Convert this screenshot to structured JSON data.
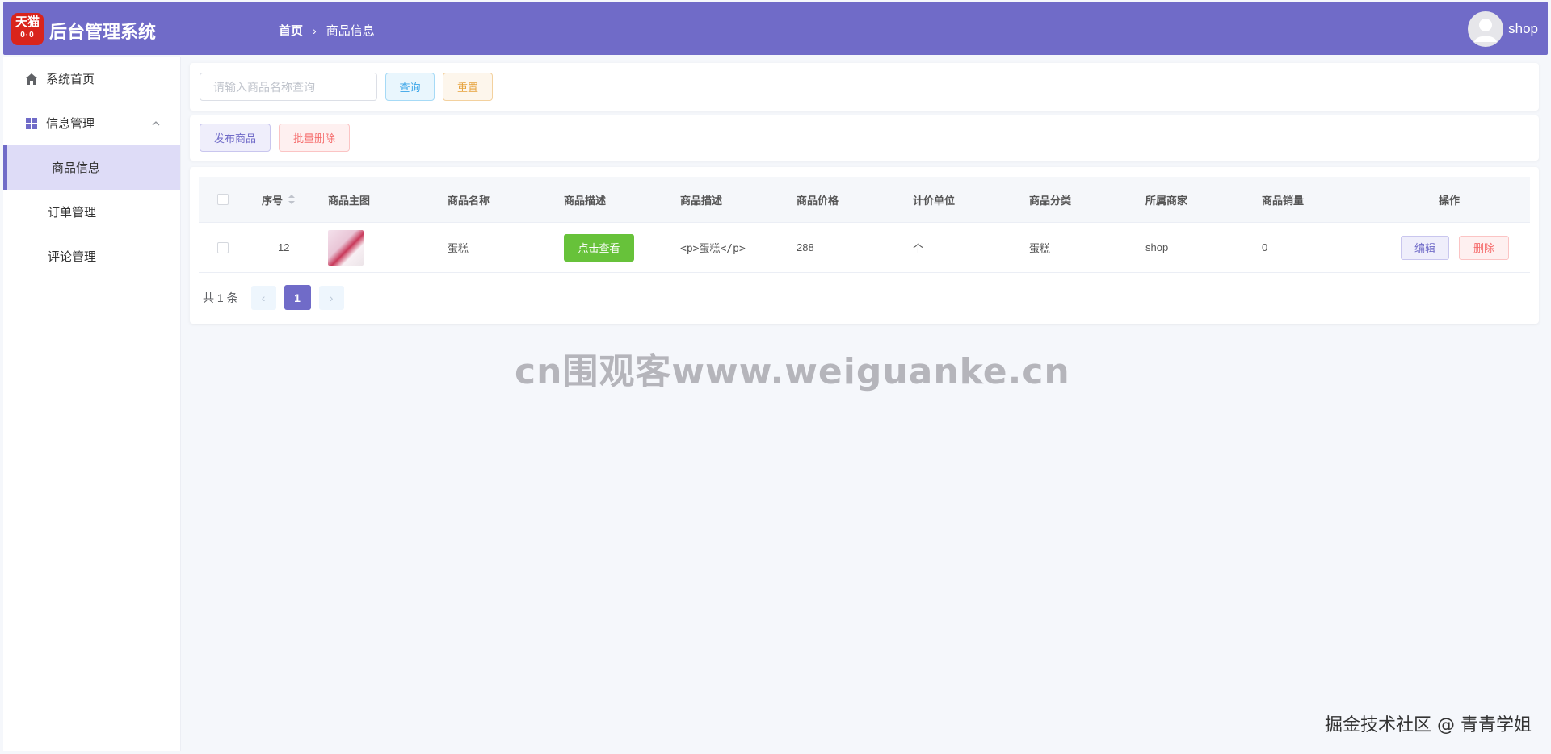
{
  "app": {
    "title": "后台管理系统",
    "logo_text": "天猫",
    "logo_sub": "0·0"
  },
  "breadcrumb": {
    "home": "首页",
    "separator": "›",
    "current": "商品信息"
  },
  "user": {
    "name": "shop",
    "avatar_icon": "user-avatar-icon"
  },
  "sidebar": {
    "items": [
      {
        "label": "系统首页",
        "icon": "home-icon"
      },
      {
        "label": "信息管理",
        "icon": "grid-icon",
        "expanded": true
      },
      {
        "label": "商品信息",
        "active": true
      },
      {
        "label": "订单管理"
      },
      {
        "label": "评论管理"
      }
    ]
  },
  "search": {
    "placeholder": "请输入商品名称查询",
    "value": "",
    "query_label": "查询",
    "reset_label": "重置"
  },
  "actions": {
    "publish_label": "发布商品",
    "batch_delete_label": "批量删除"
  },
  "table": {
    "headers": [
      "序号",
      "商品主图",
      "商品名称",
      "商品描述",
      "商品描述",
      "商品价格",
      "计价单位",
      "商品分类",
      "所属商家",
      "商品销量",
      "操作"
    ],
    "rows": [
      {
        "id": "12",
        "name": "蛋糕",
        "desc_button": "点击查看",
        "desc_text": "<p>蛋糕</p>",
        "price": "288",
        "unit": "个",
        "category": "蛋糕",
        "merchant": "shop",
        "sales": "0",
        "edit_label": "编辑",
        "delete_label": "删除"
      }
    ]
  },
  "pagination": {
    "total_text": "共 1 条",
    "current_page": "1",
    "prev": "‹",
    "next": "›"
  },
  "watermark": "cn围观客www.weiguanke.cn",
  "credit": "掘金技术社区 @ 青青学姐",
  "colors": {
    "primary": "#706bc8",
    "success": "#67c23a",
    "danger": "#f56c6c",
    "warning": "#e6a23c",
    "info": "#3ba5e8"
  }
}
